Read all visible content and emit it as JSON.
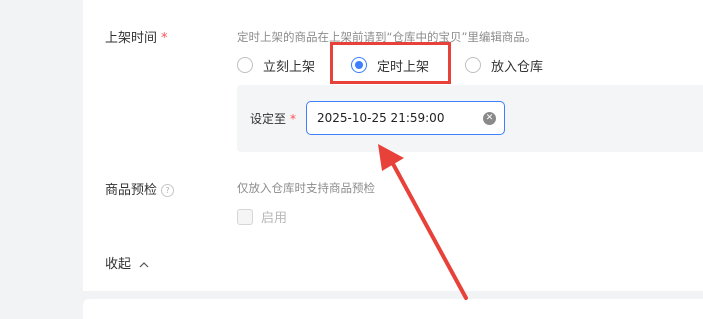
{
  "shelf_time": {
    "label": "上架时间",
    "required_mark": "*",
    "hint": "定时上架的商品在上架前请到“仓库中的宝贝”里编辑商品。",
    "options": [
      {
        "label": "立刻上架",
        "checked": false
      },
      {
        "label": "定时上架",
        "checked": true
      },
      {
        "label": "放入仓库",
        "checked": false
      }
    ],
    "schedule": {
      "label": "设定至",
      "required_mark": "*",
      "value": "2025-10-25 21:59:00"
    }
  },
  "preinspect": {
    "label": "商品预检",
    "hint": "仅放入仓库时支持商品预检",
    "checkbox_label": "启用",
    "enabled": false
  },
  "collapse": {
    "label": "收起",
    "icon": "chevron-up-icon"
  },
  "colors": {
    "accent": "#3d7fff",
    "annotation": "#e8413a",
    "required": "#ff4d4f"
  }
}
